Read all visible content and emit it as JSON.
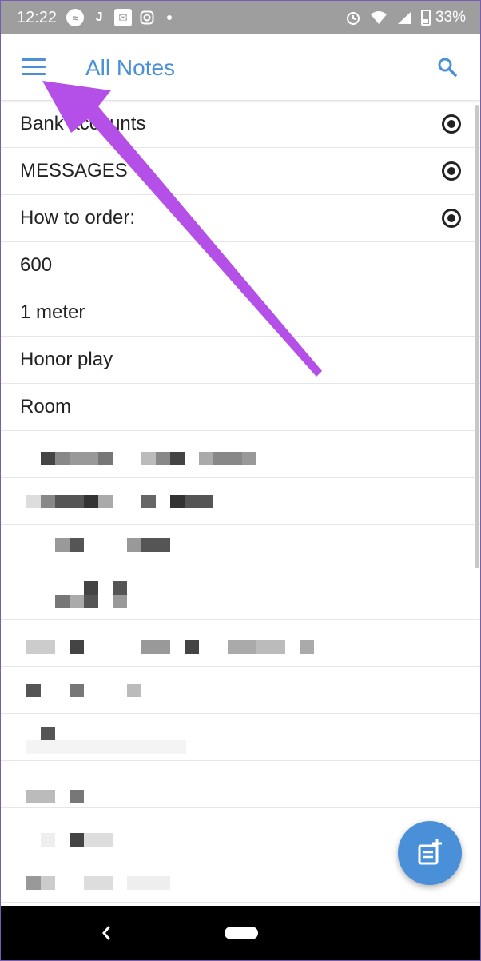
{
  "status_bar": {
    "time": "12:22",
    "notification_icons": [
      "messenger-icon",
      "j-icon",
      "mail-icon",
      "instagram-icon",
      "dot-icon"
    ],
    "right_icons": [
      "alarm-icon",
      "wifi-icon",
      "signal-icon",
      "battery-icon"
    ],
    "battery_percent": "33%"
  },
  "app_bar": {
    "title": "All Notes",
    "accent_color": "#4a90d9",
    "menu_icon": "menu-icon",
    "search_icon": "search-icon"
  },
  "notes": [
    {
      "title": "Bank accounts",
      "pinned": true
    },
    {
      "title": "MESSAGES",
      "pinned": true
    },
    {
      "title": "How to order:",
      "pinned": true
    },
    {
      "title": "600",
      "pinned": false
    },
    {
      "title": "1 meter",
      "pinned": false
    },
    {
      "title": "Honor play",
      "pinned": false
    },
    {
      "title": "Room",
      "pinned": false
    }
  ],
  "fab": {
    "icon": "new-note-icon"
  },
  "nav_bar": {
    "back_icon": "back-icon",
    "home_icon": "home-pill-icon"
  },
  "overlay": {
    "arrow_color": "#b44fe8"
  }
}
